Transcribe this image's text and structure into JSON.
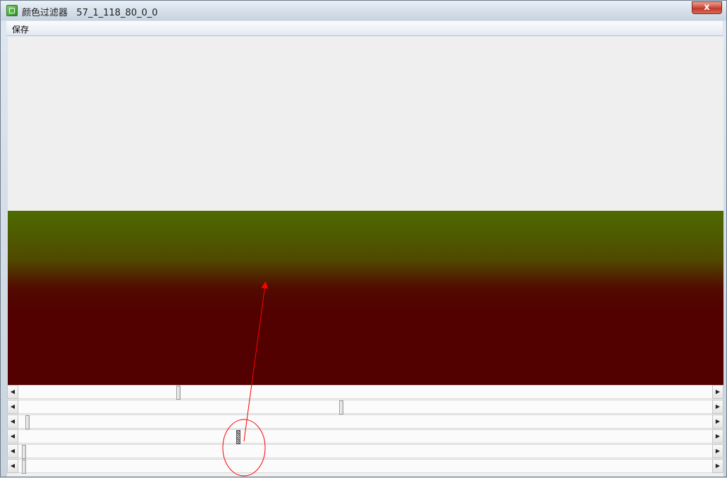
{
  "window": {
    "title": "颜色过滤器",
    "subtitle": "57_1_118_80_0_0",
    "close_label": "x"
  },
  "menu": {
    "items": [
      {
        "label": "保存"
      }
    ]
  },
  "canvas": {
    "top_color": "#efefef",
    "gradient_colors": [
      "#4e6b00",
      "#4f4a00",
      "#520c00",
      "#520000"
    ]
  },
  "sliders": [
    {
      "name": "slider-1",
      "value_fraction": 0.228,
      "style": "normal"
    },
    {
      "name": "slider-2",
      "value_fraction": 0.463,
      "style": "normal"
    },
    {
      "name": "slider-3",
      "value_fraction": 0.011,
      "style": "normal"
    },
    {
      "name": "slider-4",
      "value_fraction": 0.315,
      "style": "hatched"
    },
    {
      "name": "slider-5",
      "value_fraction": 0.006,
      "style": "normal"
    },
    {
      "name": "slider-6",
      "value_fraction": 0.006,
      "style": "normal"
    }
  ],
  "icons": {
    "app": "color-filter-app-icon",
    "left_arrow": "scroll-left-icon",
    "right_arrow": "scroll-right-icon"
  },
  "annotation_color": "#ff0000"
}
